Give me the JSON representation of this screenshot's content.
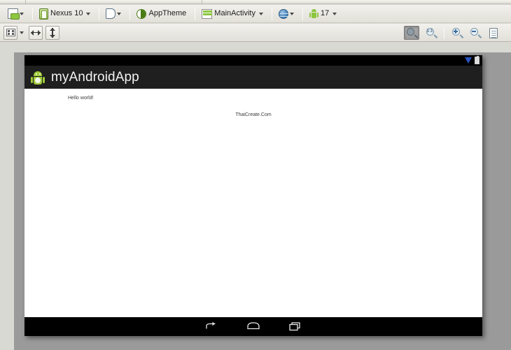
{
  "app": {
    "name": "android-layout-editor",
    "background_color": "#d9d9d4"
  },
  "toolbar_primary": {
    "items": [
      {
        "name": "device-config",
        "icon": "device-icon",
        "label": "",
        "has_caret": true
      },
      {
        "name": "device-select",
        "icon": "nexus-device-icon",
        "label": "Nexus 10",
        "has_caret": true
      },
      {
        "name": "orientation-select",
        "icon": "orientation-icon",
        "label": "",
        "has_caret": true
      },
      {
        "name": "theme-select",
        "icon": "theme-contrast-icon",
        "label": "AppTheme",
        "has_caret": false
      },
      {
        "name": "activity-select",
        "icon": "activity-layout-icon",
        "label": "MainActivity",
        "has_caret": true
      },
      {
        "name": "locale-select",
        "icon": "globe-icon",
        "label": "",
        "has_caret": true
      },
      {
        "name": "api-level-select",
        "icon": "android-icon",
        "label": "17",
        "has_caret": true
      }
    ]
  },
  "toolbar_secondary": {
    "left_buttons": [
      {
        "name": "fit-to-screen-button",
        "icon": "fit-screen-icon",
        "has_caret": true
      },
      {
        "name": "fit-width-button",
        "icon": "fit-width-icon",
        "has_caret": false
      },
      {
        "name": "fit-height-button",
        "icon": "fit-height-icon",
        "has_caret": false
      }
    ],
    "right_buttons": [
      {
        "name": "zoom-fit-toggle",
        "icon": "zoom-fit-icon",
        "pressed": true,
        "label": ""
      },
      {
        "name": "zoom-actual-size-button",
        "icon": "zoom-one-to-one-icon",
        "pressed": false,
        "label": "1:1"
      },
      {
        "name": "zoom-in-button",
        "icon": "zoom-in-icon",
        "pressed": false,
        "label": ""
      },
      {
        "name": "zoom-out-button",
        "icon": "zoom-out-icon",
        "pressed": false,
        "label": ""
      },
      {
        "name": "refresh-render-button",
        "icon": "document-icon",
        "pressed": false,
        "label": ""
      }
    ]
  },
  "preview": {
    "status_bar": {
      "signal_icon": "signal-triangle-icon",
      "battery_icon": "battery-icon"
    },
    "app_bar": {
      "icon": "android-robot-icon",
      "title": "myAndroidApp",
      "background_color": "#1f1f1f"
    },
    "content": {
      "background_color": "#ffffff",
      "hello_text": "Hello world!",
      "center_text": "ThaiCreate.Com"
    },
    "nav_bar": {
      "background_color": "#000000",
      "buttons": [
        {
          "name": "nav-back-button",
          "icon": "back-arrow-icon"
        },
        {
          "name": "nav-home-button",
          "icon": "home-icon"
        },
        {
          "name": "nav-recents-button",
          "icon": "recents-icon"
        }
      ]
    }
  }
}
